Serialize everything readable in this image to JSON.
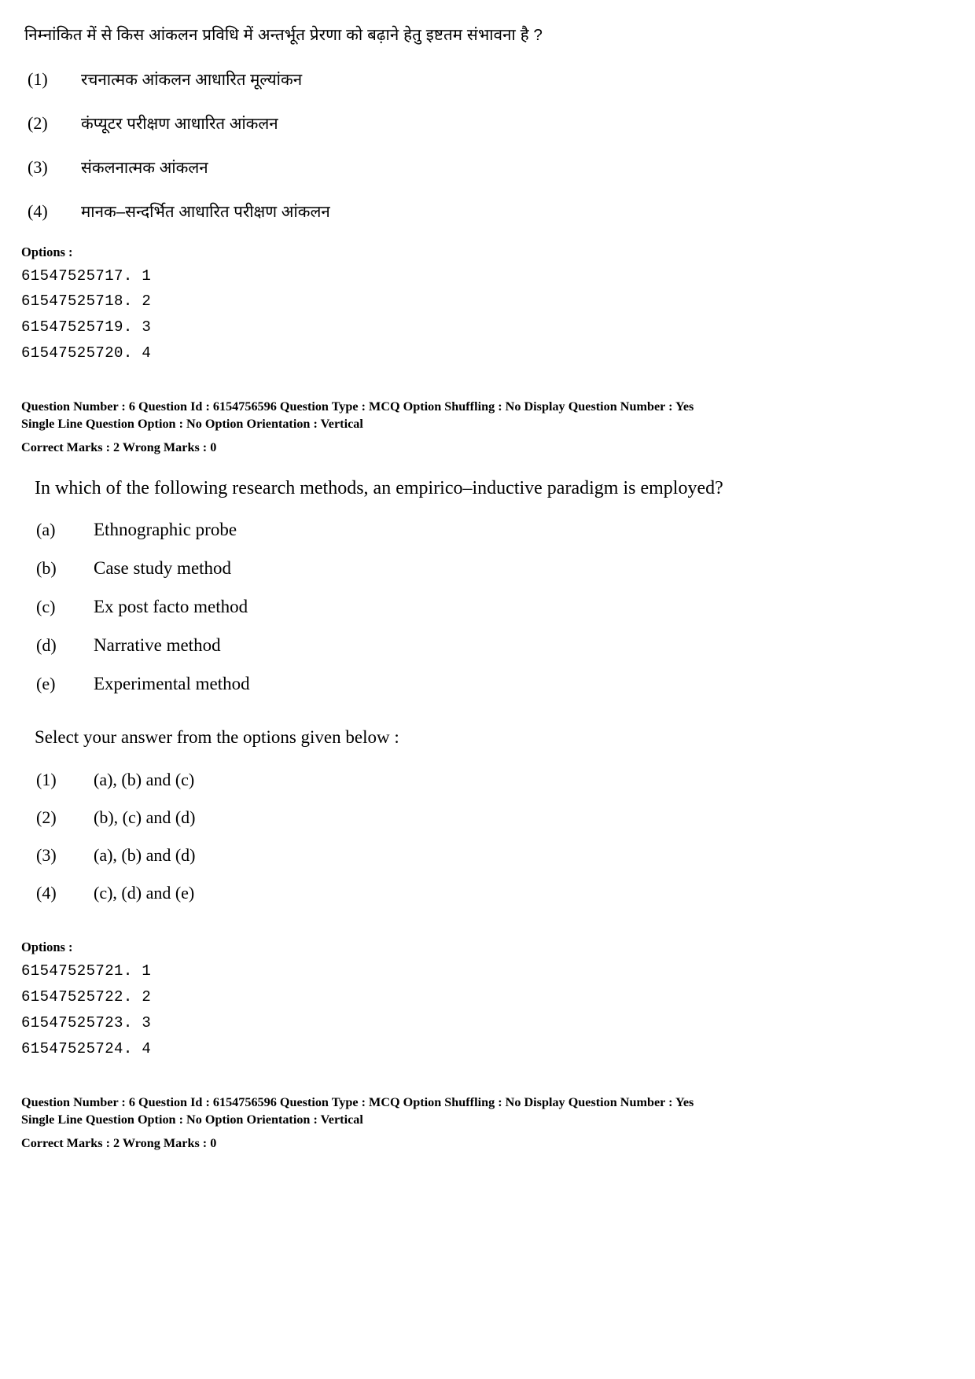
{
  "hindi_question": {
    "text": "निम्नांकित में से किस आंकलन प्रविधि में अन्तर्भूत प्रेरणा को बढ़ाने हेतु इष्टतम संभावना है ?",
    "options": [
      {
        "num": "(1)",
        "text": "रचनात्मक आंकलन आधारित मूल्यांकन"
      },
      {
        "num": "(2)",
        "text": "कंप्यूटर परीक्षण आधारित आंकलन"
      },
      {
        "num": "(3)",
        "text": "संकलनात्मक आंकलन"
      },
      {
        "num": "(4)",
        "text": "मानक–सन्दर्भित आधारित परीक्षण आंकलन"
      }
    ],
    "options_header": "Options :",
    "option_ids": [
      "61547525717. 1",
      "61547525718. 2",
      "61547525719. 3",
      "61547525720. 4"
    ]
  },
  "meta_top": {
    "line1": "Question Number : 6  Question Id : 6154756596  Question Type : MCQ  Option Shuffling : No  Display Question Number : Yes",
    "line2": "Single Line Question Option : No  Option Orientation : Vertical",
    "marks": "Correct Marks : 2  Wrong Marks : 0"
  },
  "english_question": {
    "text": "In which of the following research methods, an empirico–inductive paradigm is employed?",
    "statements": [
      {
        "label": "(a)",
        "text": "Ethnographic probe"
      },
      {
        "label": "(b)",
        "text": "Case study method"
      },
      {
        "label": "(c)",
        "text": "Ex post facto method"
      },
      {
        "label": "(d)",
        "text": "Narrative method"
      },
      {
        "label": "(e)",
        "text": "Experimental method"
      }
    ],
    "select_line": "Select your answer from the options given below :",
    "options": [
      {
        "num": "(1)",
        "text": "(a), (b) and (c)"
      },
      {
        "num": "(2)",
        "text": "(b), (c) and (d)"
      },
      {
        "num": "(3)",
        "text": "(a), (b) and (d)"
      },
      {
        "num": "(4)",
        "text": "(c), (d) and (e)"
      }
    ],
    "options_header": "Options :",
    "option_ids": [
      "61547525721. 1",
      "61547525722. 2",
      "61547525723. 3",
      "61547525724. 4"
    ]
  },
  "meta_bottom": {
    "line1": "Question Number : 6  Question Id : 6154756596  Question Type : MCQ  Option Shuffling : No  Display Question Number : Yes",
    "line2": "Single Line Question Option : No  Option Orientation : Vertical",
    "marks": "Correct Marks : 2  Wrong Marks : 0"
  }
}
